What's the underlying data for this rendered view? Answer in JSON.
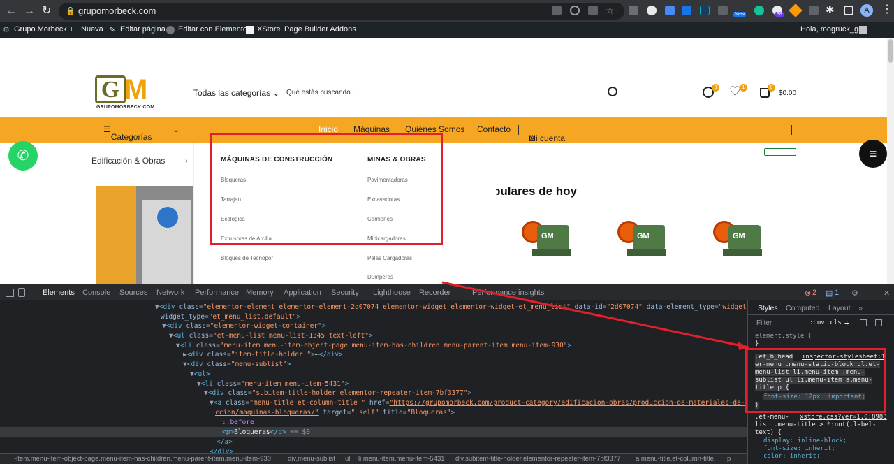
{
  "browser": {
    "url": "grupomorbeck.com",
    "new_badge": "New",
    "ext_count": "38",
    "profile_initial": "A"
  },
  "wp_admin": {
    "site": "Grupo Morbeck",
    "new": "Nueva",
    "edit_page": "Editar página",
    "edit_elementor": "Editar con Elementor",
    "xstore": "XStore",
    "page_builder": "Page Builder Addons",
    "greeting": "Hola, mogruck_gm"
  },
  "site": {
    "logo_letters_1": "G",
    "logo_letters_2": "M",
    "logo_text": "GRUPOMORBECK.COM",
    "all_categories": "Todas las categorías",
    "search_placeholder": "Qué estás buscando...",
    "compare_count": "3",
    "wishlist_count": "1",
    "cart_count": "0",
    "cart_total": "$0.00",
    "menu": {
      "categories": "Categorías",
      "home": "Inicio",
      "machines": "Máquinas",
      "about": "Quiénes Somos",
      "contact": "Contacto",
      "account": "Mi cuenta"
    },
    "sidebar_category": "Edificación & Obras",
    "mega": {
      "col1_title": "MÁQUINAS DE CONSTRUCCIÓN",
      "col1_items": [
        "Bloqueras",
        "Tarrajeo",
        "Ecológica",
        "Extrusoras de Arcilla",
        "Bloques de Tecnopor"
      ],
      "col2_title": "MINAS & OBRAS",
      "col2_items": [
        "Pavimentadoras",
        "Excavadoras",
        "Camiones",
        "Minicargadoras",
        "Palas Cargadoras",
        "Dúmperes"
      ]
    },
    "popular_title": "pulares de hoy",
    "product_label": "GM"
  },
  "devtools": {
    "tabs": [
      "Elements",
      "Console",
      "Sources",
      "Network",
      "Performance",
      "Memory",
      "Application",
      "Security",
      "Lighthouse",
      "Recorder",
      "Performance insights"
    ],
    "error_count": "2",
    "message_count": "1",
    "styles_tabs": [
      "Styles",
      "Computed",
      "Layout"
    ],
    "filter_placeholder": "Filter",
    "hov": ":hov",
    "cls": ".cls",
    "element_style": "element.style {",
    "rule1_selector": ".et_b_head",
    "rule1_source": "inspector-stylesheet:1",
    "rule1_lines": [
      "er-menu .menu-static-block ul.et-",
      "menu-list li.menu-item .menu-",
      "sublist ul li.menu-item a.menu-",
      "title p {"
    ],
    "rule1_prop": "font-size: 12px !important;",
    "rule2_line1": ".et-menu-",
    "rule2_source": "xstore.css?ver=1.0:8983",
    "rule2_lines": [
      "list .menu-title > *:not(.label-",
      "text) {"
    ],
    "rule2_props": [
      "display: inline-block;",
      "font-size: inherit;",
      "color: inherit;"
    ],
    "breadcrumbs": [
      "-item.menu-item-object-page.menu-item-has-children.menu-parent-item.menu-item-930",
      "div.menu-sublist",
      "ul",
      "li.menu-item.menu-item-5431",
      "div.subitem-title-holder.elementor-repeater-item-7bf3377",
      "a.menu-title.et-column-title.",
      "p"
    ]
  }
}
